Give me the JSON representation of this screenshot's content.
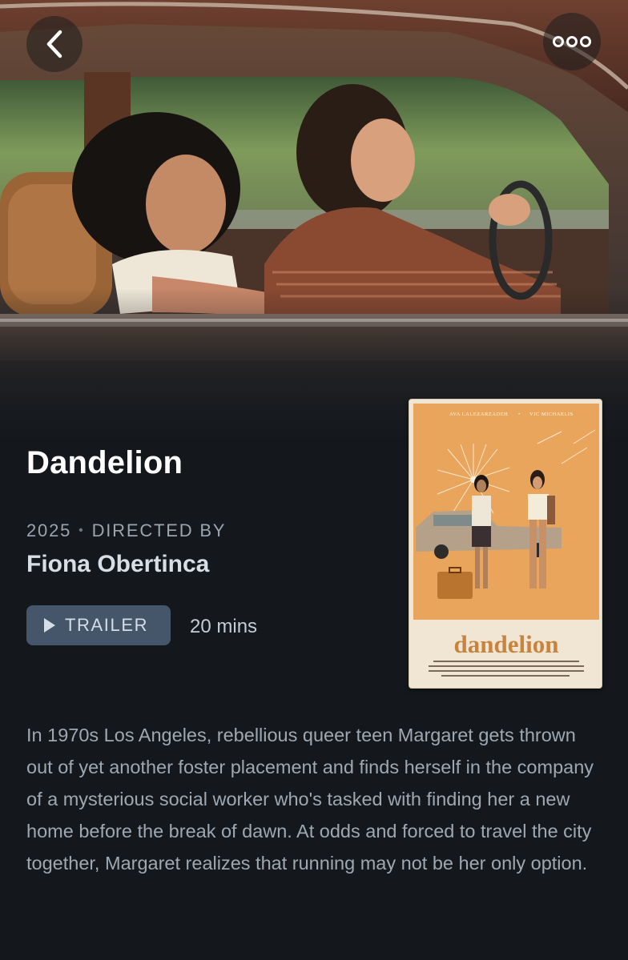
{
  "film": {
    "title": "Dandelion",
    "year": "2025",
    "directed_by_label": "DIRECTED BY",
    "director": "Fiona Obertinca",
    "trailer_label": "TRAILER",
    "runtime": "20 mins",
    "synopsis": "In 1970s Los Angeles, rebellious queer teen Margaret gets thrown out of yet another foster placement and finds herself in the company of a mysterious social worker who's tasked with finding her a new home before the break of dawn. At odds and forced to travel the city together, Margaret realizes that running may not be her only option."
  },
  "poster": {
    "cast_top_left": "AVA LALEZARZADEH",
    "cast_top_right": "VIC MICHAELIS",
    "wordmark": "dandelion",
    "accent_color": "#e9a55c",
    "wordmark_color": "#c8843f"
  },
  "nav": {
    "back_icon": "chevron-left-icon",
    "more_icon": "more-horizontal-icon"
  },
  "theme": {
    "background": "#14181c",
    "button_bg": "#45556a"
  }
}
